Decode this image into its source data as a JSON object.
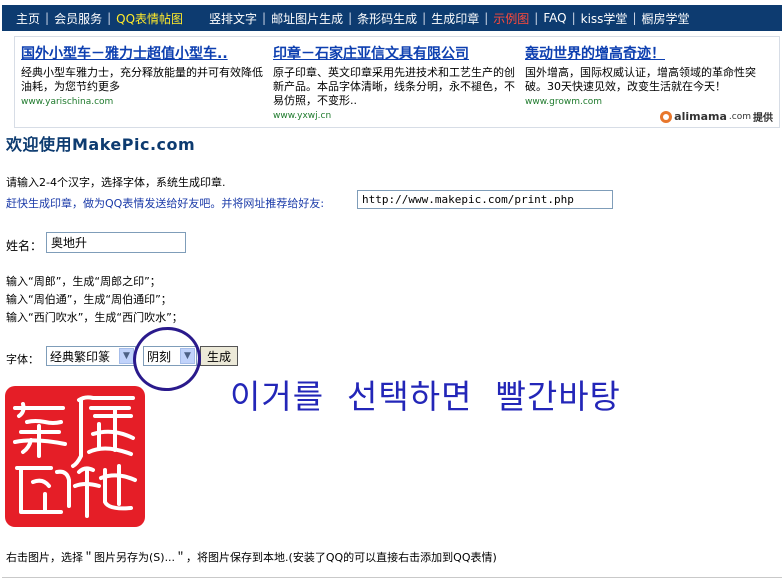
{
  "nav": {
    "items": [
      {
        "label": "主页",
        "state": "normal"
      },
      {
        "label": "会员服务",
        "state": "normal"
      },
      {
        "label": "QQ表情帖图",
        "state": "active"
      },
      {
        "label": "竖排文字",
        "state": "normal"
      },
      {
        "label": "邮址图片生成",
        "state": "normal"
      },
      {
        "label": "条形码生成",
        "state": "normal"
      },
      {
        "label": "生成印章",
        "state": "normal"
      },
      {
        "label": "示例图",
        "state": "hot"
      },
      {
        "label": "FAQ",
        "state": "normal"
      },
      {
        "label": "kiss学堂",
        "state": "normal"
      },
      {
        "label": "橱房学堂",
        "state": "normal"
      }
    ],
    "colors": {
      "bg": "#0d3b70",
      "active": "#ffea2a",
      "hot": "#ff4a3a"
    }
  },
  "ads": [
    {
      "title": "国外小型车－雅力士超值小型车..",
      "body": "经典小型车雅力士，充分释放能量的并可有效降低油耗，为您节约更多",
      "url": "www.yarischina.com"
    },
    {
      "title": "印章－石家庄亚信文具有限公司",
      "body": "原子印章、英文印章采用先进技术和工艺生产的创新产品。本品字体清晰，线条分明，永不褪色，不易仿照，不变形..",
      "url": "www.yxwj.cn"
    },
    {
      "title": "轰动世界的增高奇迹！",
      "body": "国外增高，国际权威认证，增高领域的革命性突破。30天快速见效，改变生活就在今天！",
      "url": "www.growm.com"
    }
  ],
  "alimama": {
    "brand": "alimama",
    "suffix": ".com",
    "provided": "提供"
  },
  "welcome": "欢迎使用MakePic.com",
  "instructions": {
    "line1": "请输入2-4个汉字，选择字体，系统生成印章.",
    "line2": "赶快生成印章，做为QQ表情发送给好友吧。并将网址推荐给好友:",
    "url_value": "http://www.makepic.com/print.php"
  },
  "name_field": {
    "label": "姓名：",
    "value": "奥地升"
  },
  "examples": [
    "输入“周郎”，生成“周郎之印”；",
    "输入“周伯通”，生成“周伯通印”；",
    "输入“西门吹水”，生成“西门吹水”；"
  ],
  "font_row": {
    "label": "字体：",
    "font_selected": "经典繁印篆",
    "style_selected": "阴刻",
    "generate_label": "生成"
  },
  "annotation": "이거를  선택하면  빨간바탕",
  "seal": {
    "chars": [
      "奥",
      "地",
      "升",
      "印"
    ],
    "color": "#e51e27"
  },
  "footer": "右击图片，选择＂图片另存为(S)...＂，将图片保存到本地.(安装了QQ的可以直接右击添加到QQ表情)"
}
